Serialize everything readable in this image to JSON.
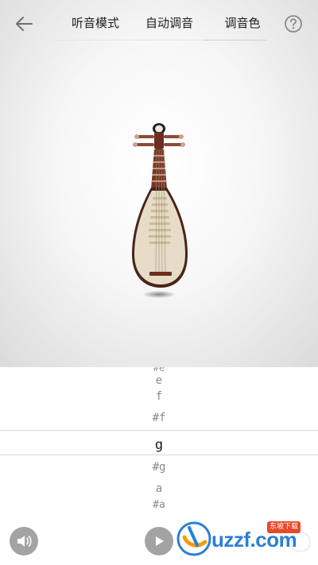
{
  "header": {
    "tabs": [
      {
        "label": "听音模式"
      },
      {
        "label": "自动调音"
      },
      {
        "label": "调音色"
      }
    ],
    "active_tab_index": 2,
    "icons": {
      "back": "arrow-left-icon",
      "help": "question-circle-icon"
    }
  },
  "instrument": {
    "name_icon": "pipa-icon"
  },
  "picker": {
    "notes_above": [
      "#e",
      "e",
      "f",
      "#f"
    ],
    "selected": "g",
    "notes_below": [
      "#g",
      "a",
      "#a"
    ]
  },
  "controls": {
    "icons": {
      "sound": "speaker-icon",
      "play": "play-icon"
    }
  },
  "watermark": {
    "logo_text": "uzzf.com",
    "badge": "东坡下载",
    "brand_color": "#2a7fd4"
  }
}
